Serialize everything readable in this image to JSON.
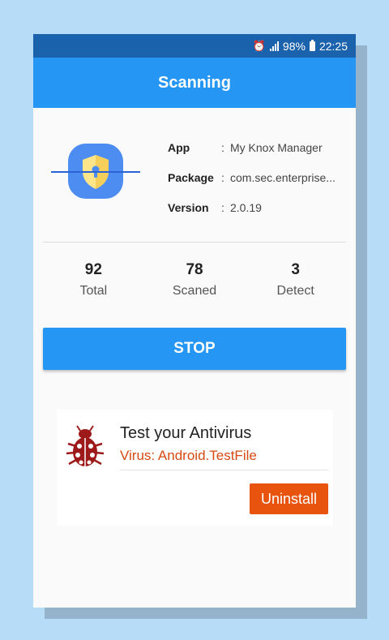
{
  "status_bar": {
    "battery": "98%",
    "time": "22:25",
    "icons": [
      "alarm-icon",
      "signal-icon",
      "battery-charging-icon"
    ]
  },
  "header": {
    "title": "Scanning"
  },
  "app_info": {
    "icon": "shield-lock-icon",
    "rows": [
      {
        "label": "App",
        "value": "My Knox Manager"
      },
      {
        "label": "Package",
        "value": "com.sec.enterprise..."
      },
      {
        "label": "Version",
        "value": "2.0.19"
      }
    ],
    "separator": ":"
  },
  "stats": [
    {
      "value": "92",
      "label": "Total"
    },
    {
      "value": "78",
      "label": "Scaned"
    },
    {
      "value": "3",
      "label": "Detect"
    }
  ],
  "actions": {
    "stop_label": "STOP"
  },
  "result": {
    "icon": "ladybug-icon",
    "title": "Test your Antivirus",
    "virus": "Virus: Android.TestFile",
    "uninstall_label": "Uninstall"
  },
  "colors": {
    "primary": "#2596f3",
    "status_bar": "#1b62ad",
    "danger": "#e8530e",
    "virus_text": "#d64a12",
    "background": "#b6dcf8"
  }
}
